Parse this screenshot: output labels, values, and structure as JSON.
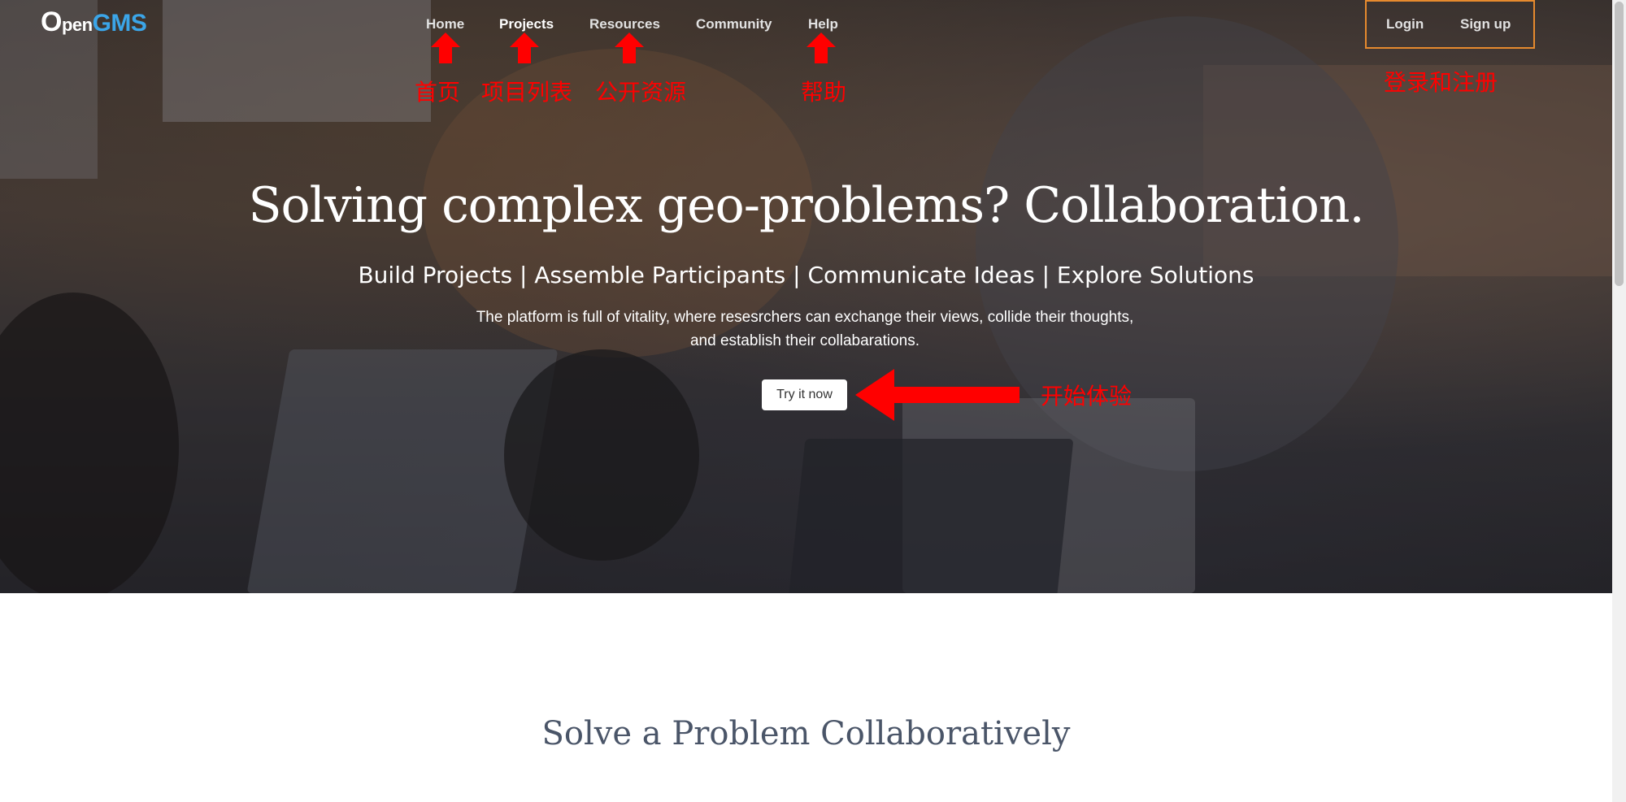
{
  "brand": {
    "logo_o": "O",
    "logo_pen": "pen",
    "logo_gms": "GMS"
  },
  "nav": {
    "items": [
      {
        "label": "Home",
        "annotation": "首页"
      },
      {
        "label": "Projects",
        "annotation": "项目列表"
      },
      {
        "label": "Resources",
        "annotation": "公开资源"
      },
      {
        "label": "Community"
      },
      {
        "label": "Help",
        "annotation": "帮助"
      }
    ],
    "login": "Login",
    "signup": "Sign up",
    "auth_annotation": "登录和注册"
  },
  "hero": {
    "title": "Solving complex geo-problems? Collaboration.",
    "subtitle": "Build Projects | Assemble Participants | Communicate Ideas | Explore Solutions",
    "description_line1": "The platform is full of vitality, where resesrchers can exchange their views, collide their thoughts,",
    "description_line2": "and establish their collabarations.",
    "cta": "Try it now",
    "cta_annotation": "开始体验"
  },
  "section": {
    "title": "Solve a Problem Collaboratively"
  },
  "colors": {
    "annotation_red": "#ff0000",
    "auth_box_orange": "#e68a2e",
    "brand_blue": "#3ba5e8"
  }
}
